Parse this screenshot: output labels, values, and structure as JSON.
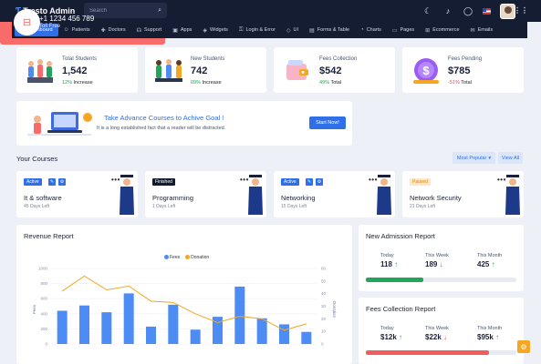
{
  "app": {
    "title": "Tresto Admin"
  },
  "search": {
    "placeholder": "Search"
  },
  "nav": [
    {
      "label": "Dashboard",
      "icon": "grid-icon"
    },
    {
      "label": "Patients",
      "icon": "users-icon"
    },
    {
      "label": "Doctors",
      "icon": "stethoscope-icon"
    },
    {
      "label": "Support",
      "icon": "headset-icon"
    },
    {
      "label": "Apps",
      "icon": "apps-icon"
    },
    {
      "label": "Widgets",
      "icon": "widget-icon"
    },
    {
      "label": "Login & Error",
      "icon": "lock-icon"
    },
    {
      "label": "UI",
      "icon": "layers-icon"
    },
    {
      "label": "Forms & Table",
      "icon": "form-icon"
    },
    {
      "label": "Charts",
      "icon": "chart-icon"
    },
    {
      "label": "Pages",
      "icon": "pages-icon"
    },
    {
      "label": "Ecommerce",
      "icon": "cart-icon"
    },
    {
      "label": "Emails",
      "icon": "mail-icon"
    }
  ],
  "stats": [
    {
      "label": "Total Students",
      "value": "1,542",
      "pct": "12%",
      "pct_color": "#21a45b",
      "suffix": "Increase"
    },
    {
      "label": "New Students",
      "value": "742",
      "pct": "09%",
      "pct_color": "#21a45b",
      "suffix": "Increase"
    },
    {
      "label": "Fees Collection",
      "value": "$542",
      "pct": "49%",
      "pct_color": "#21a45b",
      "suffix": "Total"
    },
    {
      "label": "Fees Pending",
      "value": "$785",
      "pct": "-51%",
      "pct_color": "#e34b4b",
      "suffix": "Total"
    }
  ],
  "promo": {
    "title": "Take Advance Courses to Achive Goal !",
    "text": "It is a long established fact that a reader will be distracted.",
    "button": "Start Now!"
  },
  "contact": {
    "phone": "+1 1234 456 789",
    "label": "Toll Free"
  },
  "courses_section": {
    "title": "Your Courses",
    "filter": "Most Popular",
    "view_all": "View All"
  },
  "courses": [
    {
      "status": "Active",
      "name": "It & software",
      "days": "45 Days Left"
    },
    {
      "status": "Finished",
      "name": "Programming",
      "days": "1 Days Left"
    },
    {
      "status": "Active",
      "name": "Networking",
      "days": "15 Days Left"
    },
    {
      "status": "Paused",
      "name": "Network Security",
      "days": "21 Days Left"
    }
  ],
  "revenue": {
    "title": "Revenue Report",
    "legend": [
      "Fees",
      "Donation"
    ]
  },
  "chart_data": {
    "type": "bar",
    "title": "Revenue Report",
    "x_tick_labels_visible": false,
    "ylabel": "Fees",
    "y2label": "Donation",
    "ylim": [
      0,
      1000
    ],
    "y2lim": [
      0,
      60
    ],
    "yticks": [
      0,
      200,
      400,
      600,
      800,
      1000
    ],
    "y2ticks": [
      0,
      10,
      20,
      30,
      40,
      50,
      60
    ],
    "grid": true,
    "legend": "top-center",
    "series": [
      {
        "name": "Fees",
        "type": "bar",
        "color": "#4d8cf5",
        "values": [
          440,
          510,
          420,
          670,
          230,
          520,
          190,
          360,
          760,
          340,
          260,
          160
        ]
      },
      {
        "name": "Donation",
        "type": "line",
        "color": "#f5a623",
        "values": [
          42,
          54,
          43,
          46,
          34,
          33,
          24,
          17,
          22,
          20,
          11,
          16
        ]
      }
    ]
  },
  "admission": {
    "title": "New Admission Report",
    "metrics": [
      {
        "label": "Today",
        "value": "118",
        "dir": "up",
        "color": "#21a45b",
        "arrow": "↑"
      },
      {
        "label": "This Week",
        "value": "189",
        "dir": "down",
        "color": "#e34b4b",
        "arrow": "↓"
      },
      {
        "label": "This Month",
        "value": "425",
        "dir": "up",
        "color": "#21a45b",
        "arrow": "↑"
      }
    ],
    "progress": 0.38,
    "progress_color": "#21a45b"
  },
  "fees_report": {
    "title": "Fees Collection Report",
    "metrics": [
      {
        "label": "Today",
        "value": "$12k",
        "dir": "up",
        "color": "#21a45b",
        "arrow": "↑"
      },
      {
        "label": "This Week",
        "value": "$22k",
        "dir": "down",
        "color": "#e34b4b",
        "arrow": "↓"
      },
      {
        "label": "This Month",
        "value": "$95k",
        "dir": "up",
        "color": "#21a45b",
        "arrow": "↑"
      }
    ],
    "progress": 0.82,
    "progress_color": "#f25c5c"
  }
}
